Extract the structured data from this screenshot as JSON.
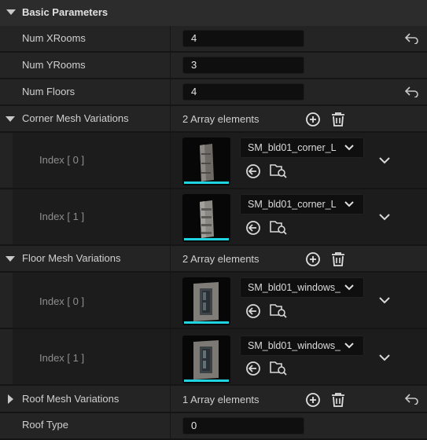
{
  "section": {
    "title": "Basic Parameters"
  },
  "props": {
    "num_xrooms": {
      "label": "Num XRooms",
      "value": "4"
    },
    "num_yrooms": {
      "label": "Num YRooms",
      "value": "3"
    },
    "num_floors": {
      "label": "Num Floors",
      "value": "4"
    },
    "roof_type": {
      "label": "Roof Type",
      "value": "0"
    }
  },
  "corner": {
    "label": "Corner Mesh Variations",
    "count": "2 Array elements",
    "items": [
      {
        "index": "Index [ 0 ]",
        "asset": "SM_bld01_corner_L"
      },
      {
        "index": "Index [ 1 ]",
        "asset": "SM_bld01_corner_L"
      }
    ]
  },
  "floor": {
    "label": "Floor Mesh Variations",
    "count": "2 Array elements",
    "items": [
      {
        "index": "Index [ 0 ]",
        "asset": "SM_bld01_windows_"
      },
      {
        "index": "Index [ 1 ]",
        "asset": "SM_bld01_windows_"
      }
    ]
  },
  "roof": {
    "label": "Roof Mesh Variations",
    "count": "1 Array elements"
  },
  "icons": {
    "reset": "reset-arrow-icon",
    "add": "add-circle-icon",
    "delete": "trash-icon",
    "browse": "browse-to-asset-icon",
    "find": "find-in-content-browser-icon",
    "expand": "chevron-down-icon"
  },
  "colors": {
    "thumb_bar": "#1fd3e0",
    "panel": "#242424",
    "field": "#0f0f0f"
  }
}
